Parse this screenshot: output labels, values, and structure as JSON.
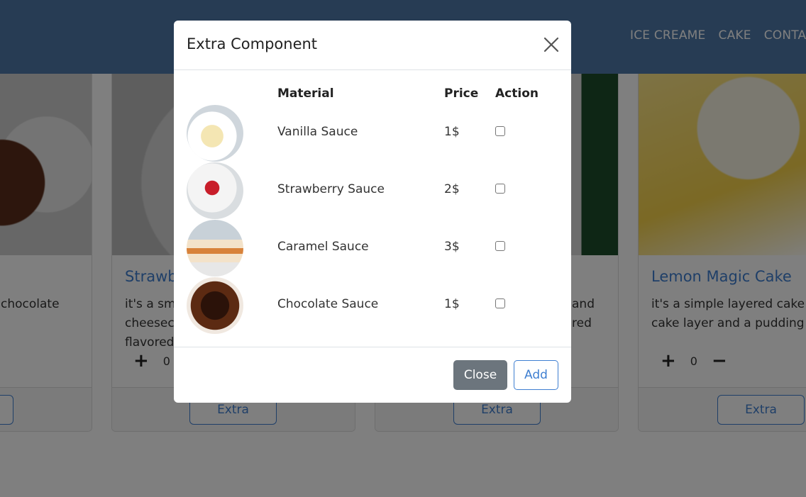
{
  "navbar": {
    "links": [
      "ICE CREAME",
      "CAKE",
      "CONTA"
    ]
  },
  "cards": [
    {
      "title": "",
      "text_lines": [
        "chocolate"
      ],
      "extra_label": ""
    },
    {
      "title": "Strawb",
      "text_lines": [
        "it's a sme",
        "cheesec",
        "flavored"
      ],
      "quantity": "0",
      "extra_label": "Extra"
    },
    {
      "title": "",
      "text_lines": [
        "and",
        "red"
      ],
      "extra_label": "Extra"
    },
    {
      "title": "Lemon Magic Cake",
      "text_lines": [
        "it's a simple layered cake f",
        "cake layer and a pudding l"
      ],
      "quantity": "0",
      "extra_label": "Extra"
    }
  ],
  "modal": {
    "title": "Extra Component",
    "headers": {
      "material": "Material",
      "price": "Price",
      "action": "Action"
    },
    "rows": [
      {
        "material": "Vanilla Sauce",
        "price": "1$",
        "checked": false
      },
      {
        "material": "Strawberry Sauce",
        "price": "2$",
        "checked": false
      },
      {
        "material": "Caramel Sauce",
        "price": "3$",
        "checked": false
      },
      {
        "material": "Chocolate Sauce",
        "price": "1$",
        "checked": false
      }
    ],
    "close_label": "Close",
    "add_label": "Add"
  },
  "colors": {
    "navbar": "#4e79a8",
    "accent": "#3f7fd1",
    "close_button": "#6c757d"
  }
}
